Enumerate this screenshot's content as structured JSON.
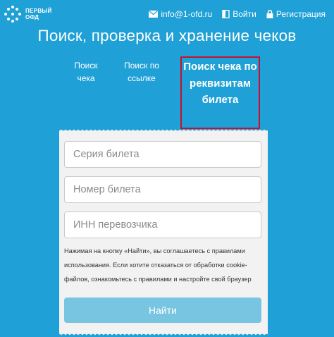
{
  "header": {
    "logo_line1": "ПЕРВЫЙ",
    "logo_line2": "ОФД",
    "email": "info@1-ofd.ru",
    "login": "Войти",
    "register": "Регистрация"
  },
  "page_title": "Поиск, проверка и хранение чеков",
  "tabs": [
    {
      "label": "Поиск чека"
    },
    {
      "label": "Поиск по ссылке"
    },
    {
      "label": "Поиск чека по реквизитам билета"
    }
  ],
  "form": {
    "ticket_series_placeholder": "Серия билета",
    "ticket_number_placeholder": "Номер билета",
    "carrier_inn_placeholder": "ИНН перевозчика",
    "consent_text": "Нажимая на кнопку «Найти», вы соглашаетесь с правилами использования. Если хотите отказаться от обработки cookie-файлов, ознакомьтесь с правилами и настройте свой браузер",
    "submit_label": "Найти"
  },
  "colors": {
    "background": "#1fa0d6",
    "active_tab_border": "#c8102e",
    "button": "#78c5e2",
    "card": "#f2f2f2"
  },
  "icons": [
    "logo-dots-icon",
    "envelope-icon",
    "login-icon",
    "lock-icon"
  ]
}
